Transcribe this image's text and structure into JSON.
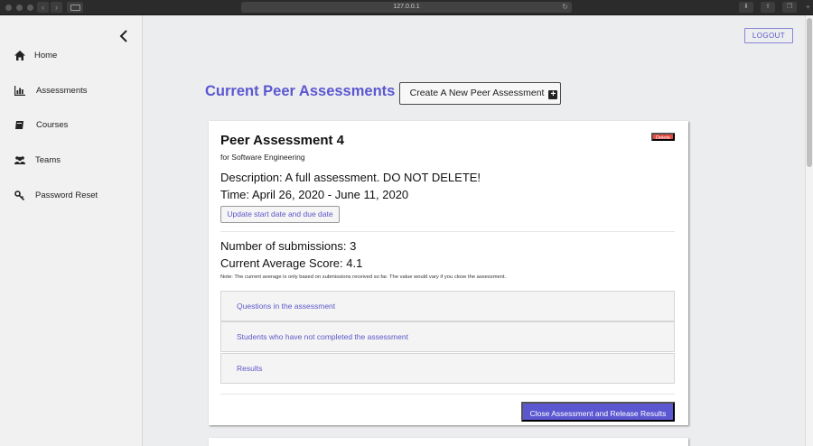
{
  "browser": {
    "address": "127.0.0.1"
  },
  "sidebar": {
    "items": [
      {
        "label": "Home",
        "icon": "home-icon"
      },
      {
        "label": "Assessments",
        "icon": "bar-chart-icon"
      },
      {
        "label": "Courses",
        "icon": "book-icon"
      },
      {
        "label": "Teams",
        "icon": "users-icon"
      },
      {
        "label": "Password Reset",
        "icon": "key-icon"
      }
    ]
  },
  "header": {
    "logout_label": "LOGOUT"
  },
  "main": {
    "title": "Current Peer Assessments",
    "create_label": "Create A New Peer Assessment",
    "create_icon": "plus-square-icon"
  },
  "assessment": {
    "title": "Peer Assessment 4",
    "delete_label": "Delete",
    "course": "for Software Engineering",
    "description_label": "Description:",
    "description_value": "A full assessment. DO NOT DELETE!",
    "time_label": "Time:",
    "time_value": "April 26, 2020 - June 11, 2020",
    "update_label": "Update start date and due date",
    "submissions_label": "Number of submissions:",
    "submissions_value": "3",
    "avg_label": "Current Average Score:",
    "avg_value": "4.1",
    "note": "Note: The current average is only based on submissions received so far. The value would vary if you close the assessment.",
    "panels": [
      "Questions in the assessment",
      "Students who have not completed the assessment",
      "Results"
    ],
    "close_label": "Close Assessment and Release Results"
  },
  "colors": {
    "accent": "#5b57d1",
    "danger": "#e5483f"
  }
}
